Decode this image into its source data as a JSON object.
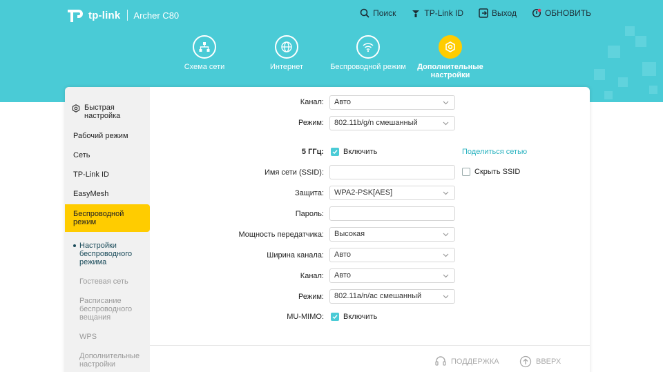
{
  "brand": {
    "logo_text": "tp-link",
    "model": "Archer C80"
  },
  "topnav": {
    "search": {
      "label": "Поиск",
      "icon": "search-icon"
    },
    "tplink_id": {
      "label": "TP-Link ID",
      "icon": "user-icon"
    },
    "logout": {
      "label": "Выход",
      "icon": "logout-icon"
    },
    "update": {
      "label": "ОБНОВИТЬ",
      "icon": "update-icon"
    }
  },
  "mainnav": {
    "items": [
      {
        "label": "Схема сети",
        "icon": "network-map-icon",
        "active": false
      },
      {
        "label": "Интернет",
        "icon": "globe-icon",
        "active": false
      },
      {
        "label": "Беспроводной режим",
        "icon": "wifi-icon",
        "active": false
      },
      {
        "label": "Дополнительные настройки",
        "icon": "gear-icon",
        "active": true
      }
    ]
  },
  "sidebar": {
    "items": [
      {
        "label": "Быстрая настройка",
        "icon": "quick-setup-icon"
      },
      {
        "label": "Рабочий режим"
      },
      {
        "label": "Сеть"
      },
      {
        "label": "TP-Link ID"
      },
      {
        "label": "EasyMesh"
      },
      {
        "label": "Беспроводной режим",
        "active": true
      }
    ],
    "subitems": [
      {
        "label": "Настройки беспроводного режима",
        "current": true
      },
      {
        "label": "Гостевая сеть"
      },
      {
        "label": "Расписание беспроводного вещания"
      },
      {
        "label": "WPS"
      },
      {
        "label": "Дополнительные настройки"
      }
    ]
  },
  "form": {
    "channel_24": {
      "label": "Канал:",
      "value": "Авто"
    },
    "mode_24": {
      "label": "Режим:",
      "value": "802.11b/g/n смешанный"
    },
    "band_5": {
      "label": "5 ГГц:",
      "checkbox_label": "Включить",
      "checked": true,
      "share_link": "Поделиться сетью"
    },
    "ssid": {
      "label": "Имя сети (SSID):",
      "value": "",
      "hide_label": "Скрыть SSID",
      "hide_checked": false
    },
    "security": {
      "label": "Защита:",
      "value": "WPA2-PSK[AES]"
    },
    "password": {
      "label": "Пароль:",
      "value": ""
    },
    "tx_power": {
      "label": "Мощность передатчика:",
      "value": "Высокая"
    },
    "channel_width": {
      "label": "Ширина канала:",
      "value": "Авто"
    },
    "channel_5": {
      "label": "Канал:",
      "value": "Авто"
    },
    "mode_5": {
      "label": "Режим:",
      "value": "802.11a/n/ac смешанный"
    },
    "mumimo": {
      "label": "MU-MIMO:",
      "checkbox_label": "Включить",
      "checked": true
    }
  },
  "footer": {
    "support": "ПОДДЕРЖКА",
    "top": "ВВЕРХ"
  },
  "colors": {
    "header_bg": "#4acbd6",
    "accent": "#ffcc00",
    "link": "#2bb3c0"
  }
}
